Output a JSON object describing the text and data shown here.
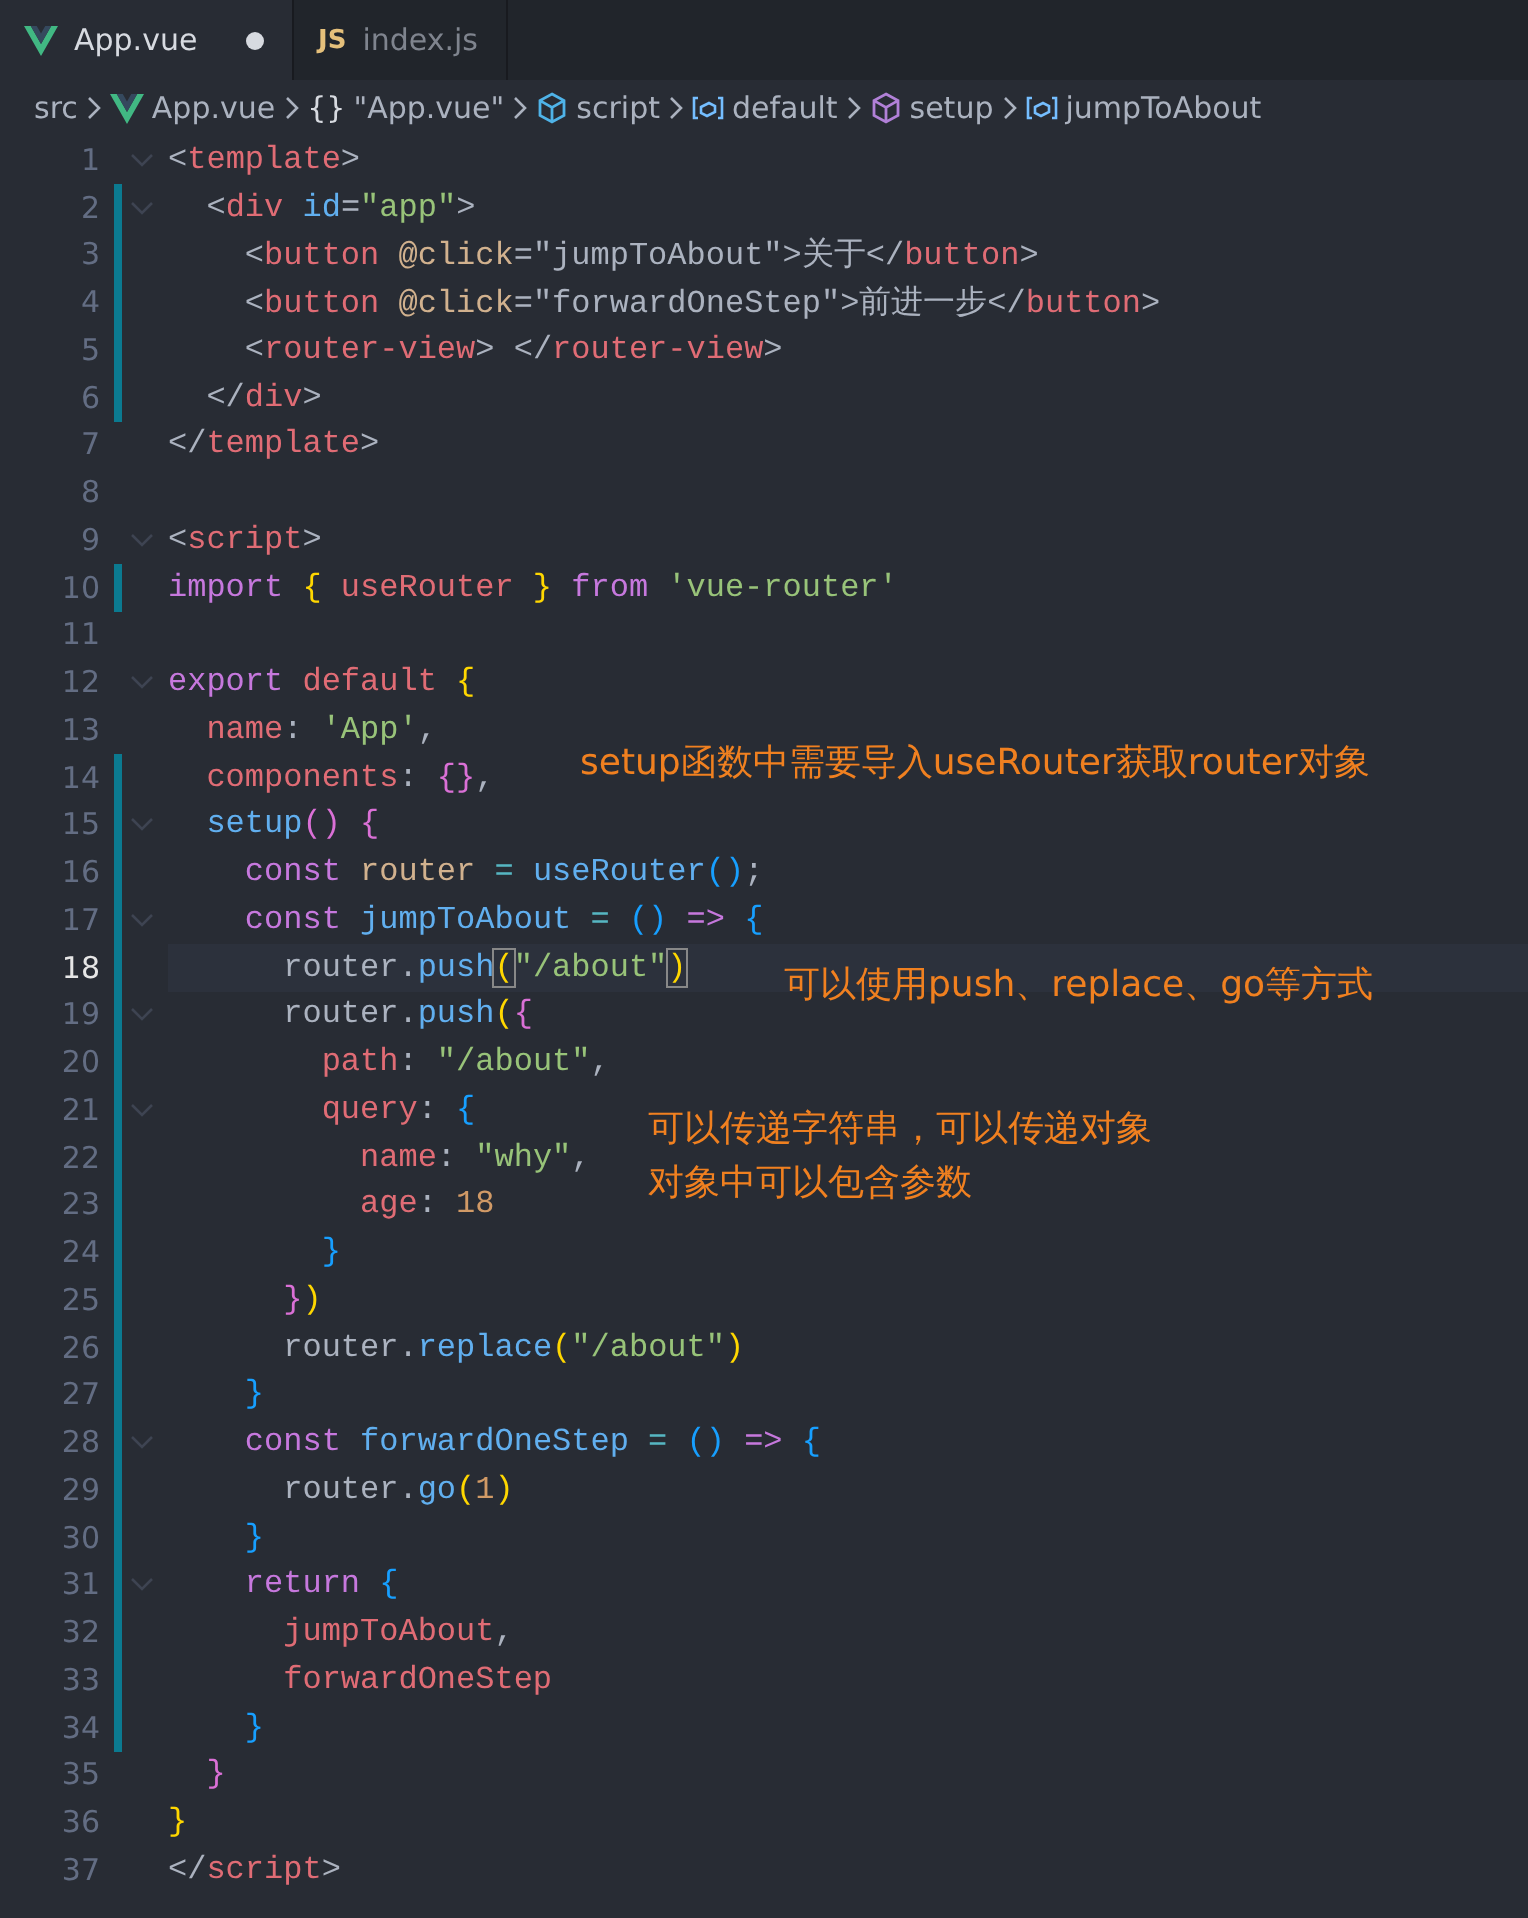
{
  "tabs": [
    {
      "label": "App.vue",
      "kind": "vue",
      "selected": true,
      "dirty": true
    },
    {
      "label": "index.js",
      "kind": "js",
      "badge": "JS",
      "selected": false,
      "dirty": false
    }
  ],
  "breadcrumb": [
    {
      "text": "src",
      "kind": "folder"
    },
    {
      "text": "App.vue",
      "kind": "file"
    },
    {
      "text": "\"App.vue\"",
      "kind": "symbol",
      "symbol": "{}"
    },
    {
      "text": "script",
      "kind": "module"
    },
    {
      "text": "default",
      "kind": "variable"
    },
    {
      "text": "setup",
      "kind": "method"
    },
    {
      "text": "jumpToAbout",
      "kind": "variable"
    }
  ],
  "lines": [
    {
      "n": "1",
      "fold": true,
      "modified": false,
      "current": false,
      "tokens": [
        {
          "kind": "p",
          "text": "<"
        },
        {
          "kind": "tag",
          "text": "template"
        },
        {
          "kind": "p",
          "text": ">"
        }
      ]
    },
    {
      "n": "2",
      "fold": true,
      "modified": true,
      "current": false,
      "tokens": [
        {
          "kind": "p",
          "text": "  <"
        },
        {
          "kind": "tag",
          "text": "div"
        },
        {
          "kind": "attr",
          "text": " id"
        },
        {
          "kind": "p",
          "text": "="
        },
        {
          "kind": "string",
          "text": "\"app\""
        },
        {
          "kind": "p",
          "text": ">"
        }
      ]
    },
    {
      "n": "3",
      "fold": false,
      "modified": true,
      "current": false,
      "tokens": [
        {
          "kind": "p",
          "text": "    <"
        },
        {
          "kind": "tag",
          "text": "button"
        },
        {
          "kind": "var",
          "text": " @click"
        },
        {
          "kind": "p",
          "text": "=\"jumpToAbout\">关于</"
        },
        {
          "kind": "tag",
          "text": "button"
        },
        {
          "kind": "p",
          "text": ">"
        }
      ]
    },
    {
      "n": "4",
      "fold": false,
      "modified": true,
      "current": false,
      "tokens": [
        {
          "kind": "p",
          "text": "    <"
        },
        {
          "kind": "tag",
          "text": "button"
        },
        {
          "kind": "var",
          "text": " @click"
        },
        {
          "kind": "p",
          "text": "=\"forwardOneStep\">前进一步</"
        },
        {
          "kind": "tag",
          "text": "button"
        },
        {
          "kind": "p",
          "text": ">"
        }
      ]
    },
    {
      "n": "5",
      "fold": false,
      "modified": true,
      "current": false,
      "tokens": [
        {
          "kind": "p",
          "text": "    <"
        },
        {
          "kind": "tag",
          "text": "router-view"
        },
        {
          "kind": "p",
          "text": "> </"
        },
        {
          "kind": "tag",
          "text": "router-view"
        },
        {
          "kind": "p",
          "text": ">"
        }
      ]
    },
    {
      "n": "6",
      "fold": false,
      "modified": true,
      "current": false,
      "tokens": [
        {
          "kind": "p",
          "text": "  </"
        },
        {
          "kind": "tag",
          "text": "div"
        },
        {
          "kind": "p",
          "text": ">"
        }
      ]
    },
    {
      "n": "7",
      "fold": false,
      "modified": false,
      "current": false,
      "tokens": [
        {
          "kind": "p",
          "text": "</"
        },
        {
          "kind": "tag",
          "text": "template"
        },
        {
          "kind": "p",
          "text": ">"
        }
      ]
    },
    {
      "n": "8",
      "fold": false,
      "modified": false,
      "current": false
    },
    {
      "n": "9",
      "fold": true,
      "modified": false,
      "current": false,
      "tokens": [
        {
          "kind": "p",
          "text": "<"
        },
        {
          "kind": "tag",
          "text": "script"
        },
        {
          "kind": "p",
          "text": ">"
        }
      ]
    },
    {
      "n": "10",
      "fold": false,
      "modified": true,
      "current": false,
      "tokens": [
        {
          "kind": "kw",
          "text": "import"
        },
        {
          "kind": "b1",
          "text": " {"
        },
        {
          "kind": "prop",
          "text": " useRouter"
        },
        {
          "kind": "b1",
          "text": " }"
        },
        {
          "kind": "kw",
          "text": " from"
        },
        {
          "kind": "string",
          "text": " 'vue-router'"
        }
      ]
    },
    {
      "n": "11",
      "fold": false,
      "modified": false,
      "current": false
    },
    {
      "n": "12",
      "fold": true,
      "modified": false,
      "current": false,
      "tokens": [
        {
          "kind": "kw",
          "text": "export"
        },
        {
          "kind": "prop",
          "text": " default"
        },
        {
          "kind": "b1",
          "text": " {"
        }
      ]
    },
    {
      "n": "13",
      "fold": false,
      "modified": false,
      "current": false,
      "tokens": [
        {
          "kind": "prop",
          "text": "  name"
        },
        {
          "kind": "p",
          "text": ":"
        },
        {
          "kind": "string",
          "text": " 'App'"
        },
        {
          "kind": "p",
          "text": ","
        }
      ]
    },
    {
      "n": "14",
      "fold": false,
      "modified": true,
      "current": false,
      "tokens": [
        {
          "kind": "prop",
          "text": "  components"
        },
        {
          "kind": "p",
          "text": ":"
        },
        {
          "kind": "b2",
          "text": " {}"
        },
        {
          "kind": "p",
          "text": ","
        }
      ]
    },
    {
      "n": "15",
      "fold": true,
      "modified": true,
      "current": false,
      "tokens": [
        {
          "kind": "func",
          "text": "  setup"
        },
        {
          "kind": "b2",
          "text": "() {"
        }
      ]
    },
    {
      "n": "16",
      "fold": false,
      "modified": true,
      "current": false,
      "tokens": [
        {
          "kind": "kw",
          "text": "    const"
        },
        {
          "kind": "var",
          "text": " router"
        },
        {
          "kind": "op",
          "text": " ="
        },
        {
          "kind": "func",
          "text": " useRouter"
        },
        {
          "kind": "b3",
          "text": "()"
        },
        {
          "kind": "p",
          "text": ";"
        }
      ]
    },
    {
      "n": "17",
      "fold": true,
      "modified": true,
      "current": false,
      "tokens": [
        {
          "kind": "kw",
          "text": "    const"
        },
        {
          "kind": "func",
          "text": " jumpToAbout"
        },
        {
          "kind": "op",
          "text": " ="
        },
        {
          "kind": "b3",
          "text": " ()"
        },
        {
          "kind": "kw",
          "text": " =>"
        },
        {
          "kind": "b3",
          "text": " {"
        }
      ]
    },
    {
      "n": "18",
      "fold": false,
      "modified": true,
      "current": true,
      "tokens": [
        {
          "kind": "p",
          "text": "      router."
        },
        {
          "kind": "func",
          "text": "push"
        },
        {
          "kind": "bm",
          "text": "("
        },
        {
          "kind": "string",
          "text": "\"/about\""
        },
        {
          "kind": "bm",
          "text": ")"
        }
      ]
    },
    {
      "n": "19",
      "fold": true,
      "modified": true,
      "current": false,
      "tokens": [
        {
          "kind": "p",
          "text": "      router."
        },
        {
          "kind": "func",
          "text": "push"
        },
        {
          "kind": "b1",
          "text": "("
        },
        {
          "kind": "b2",
          "text": "{"
        }
      ]
    },
    {
      "n": "20",
      "fold": false,
      "modified": true,
      "current": false,
      "tokens": [
        {
          "kind": "prop",
          "text": "        path"
        },
        {
          "kind": "p",
          "text": ":"
        },
        {
          "kind": "string",
          "text": " \"/about\""
        },
        {
          "kind": "p",
          "text": ","
        }
      ]
    },
    {
      "n": "21",
      "fold": true,
      "modified": true,
      "current": false,
      "tokens": [
        {
          "kind": "prop",
          "text": "        query"
        },
        {
          "kind": "p",
          "text": ":"
        },
        {
          "kind": "b3",
          "text": " {"
        }
      ]
    },
    {
      "n": "22",
      "fold": false,
      "modified": true,
      "current": false,
      "tokens": [
        {
          "kind": "prop",
          "text": "          name"
        },
        {
          "kind": "p",
          "text": ":"
        },
        {
          "kind": "string",
          "text": " \"why\""
        },
        {
          "kind": "p",
          "text": ","
        }
      ]
    },
    {
      "n": "23",
      "fold": false,
      "modified": true,
      "current": false,
      "tokens": [
        {
          "kind": "prop",
          "text": "          age"
        },
        {
          "kind": "p",
          "text": ":"
        },
        {
          "kind": "num",
          "text": " 18"
        }
      ]
    },
    {
      "n": "24",
      "fold": false,
      "modified": true,
      "current": false,
      "tokens": [
        {
          "kind": "b3",
          "text": "        }"
        }
      ]
    },
    {
      "n": "25",
      "fold": false,
      "modified": true,
      "current": false,
      "tokens": [
        {
          "kind": "b2",
          "text": "      }"
        },
        {
          "kind": "b1",
          "text": ")"
        }
      ]
    },
    {
      "n": "26",
      "fold": false,
      "modified": true,
      "current": false,
      "tokens": [
        {
          "kind": "p",
          "text": "      router."
        },
        {
          "kind": "func",
          "text": "replace"
        },
        {
          "kind": "b1",
          "text": "("
        },
        {
          "kind": "string",
          "text": "\"/about\""
        },
        {
          "kind": "b1",
          "text": ")"
        }
      ]
    },
    {
      "n": "27",
      "fold": false,
      "modified": true,
      "current": false,
      "tokens": [
        {
          "kind": "b3",
          "text": "    }"
        }
      ]
    },
    {
      "n": "28",
      "fold": true,
      "modified": true,
      "current": false,
      "tokens": [
        {
          "kind": "kw",
          "text": "    const"
        },
        {
          "kind": "func",
          "text": " forwardOneStep"
        },
        {
          "kind": "op",
          "text": " ="
        },
        {
          "kind": "b3",
          "text": " ()"
        },
        {
          "kind": "kw",
          "text": " =>"
        },
        {
          "kind": "b3",
          "text": " {"
        }
      ]
    },
    {
      "n": "29",
      "fold": false,
      "modified": true,
      "current": false,
      "tokens": [
        {
          "kind": "p",
          "text": "      router."
        },
        {
          "kind": "func",
          "text": "go"
        },
        {
          "kind": "b1",
          "text": "("
        },
        {
          "kind": "num",
          "text": "1"
        },
        {
          "kind": "b1",
          "text": ")"
        }
      ]
    },
    {
      "n": "30",
      "fold": false,
      "modified": true,
      "current": false,
      "tokens": [
        {
          "kind": "b3",
          "text": "    }"
        }
      ]
    },
    {
      "n": "31",
      "fold": true,
      "modified": true,
      "current": false,
      "tokens": [
        {
          "kind": "kw",
          "text": "    return"
        },
        {
          "kind": "b3",
          "text": " {"
        }
      ]
    },
    {
      "n": "32",
      "fold": false,
      "modified": true,
      "current": false,
      "tokens": [
        {
          "kind": "prop",
          "text": "      jumpToAbout"
        },
        {
          "kind": "p",
          "text": ","
        }
      ]
    },
    {
      "n": "33",
      "fold": false,
      "modified": true,
      "current": false,
      "tokens": [
        {
          "kind": "prop",
          "text": "      forwardOneStep"
        }
      ]
    },
    {
      "n": "34",
      "fold": false,
      "modified": true,
      "current": false,
      "tokens": [
        {
          "kind": "b3",
          "text": "    }"
        }
      ]
    },
    {
      "n": "35",
      "fold": false,
      "modified": false,
      "current": false,
      "tokens": [
        {
          "kind": "b2",
          "text": "  }"
        }
      ]
    },
    {
      "n": "36",
      "fold": false,
      "modified": false,
      "current": false,
      "tokens": [
        {
          "kind": "b1",
          "text": "}"
        }
      ]
    },
    {
      "n": "37",
      "fold": false,
      "modified": false,
      "current": false,
      "tokens": [
        {
          "kind": "p",
          "text": "</"
        },
        {
          "kind": "tag",
          "text": "script"
        },
        {
          "kind": "p",
          "text": ">"
        }
      ]
    }
  ],
  "annotations": [
    "setup函数中需要导入useRouter获取router对象",
    "可以使用push、replace、go等方式",
    "可以传递字符串，可以传递对象",
    "对象中可以包含参数"
  ]
}
